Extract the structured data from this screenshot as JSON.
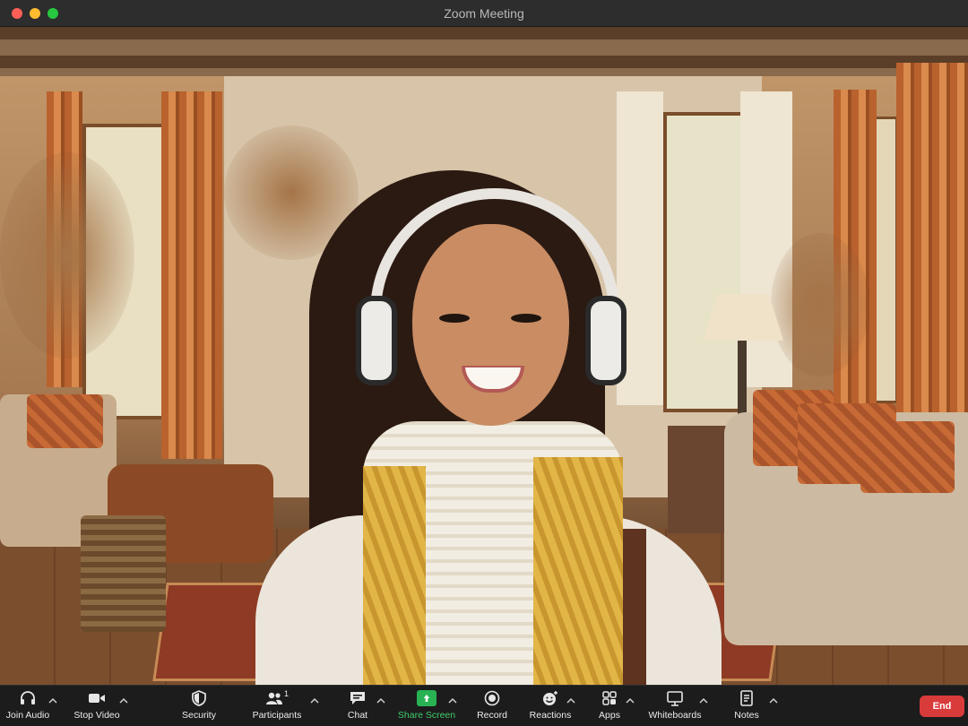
{
  "window": {
    "title": "Zoom Meeting"
  },
  "toolbar": {
    "items": [
      {
        "label": "Join Audio",
        "icon": "headphones-icon"
      },
      {
        "label": "Stop Video",
        "icon": "video-camera-icon"
      },
      {
        "label": "Security",
        "icon": "shield-icon"
      },
      {
        "label": "Participants",
        "icon": "participants-icon",
        "count": "1"
      },
      {
        "label": "Chat",
        "icon": "chat-bubble-icon"
      },
      {
        "label": "Share Screen",
        "icon": "share-screen-icon"
      },
      {
        "label": "Record",
        "icon": "record-icon"
      },
      {
        "label": "Reactions",
        "icon": "emoji-icon"
      },
      {
        "label": "Apps",
        "icon": "apps-icon"
      },
      {
        "label": "Whiteboards",
        "icon": "whiteboard-icon"
      },
      {
        "label": "Notes",
        "icon": "notes-icon"
      }
    ],
    "end_label": "End"
  },
  "colors": {
    "toolbar_bg": "#1c1c1c",
    "share_green": "#28b253",
    "end_red": "#d93b3b",
    "titlebar_bg": "#2d2d2d"
  }
}
